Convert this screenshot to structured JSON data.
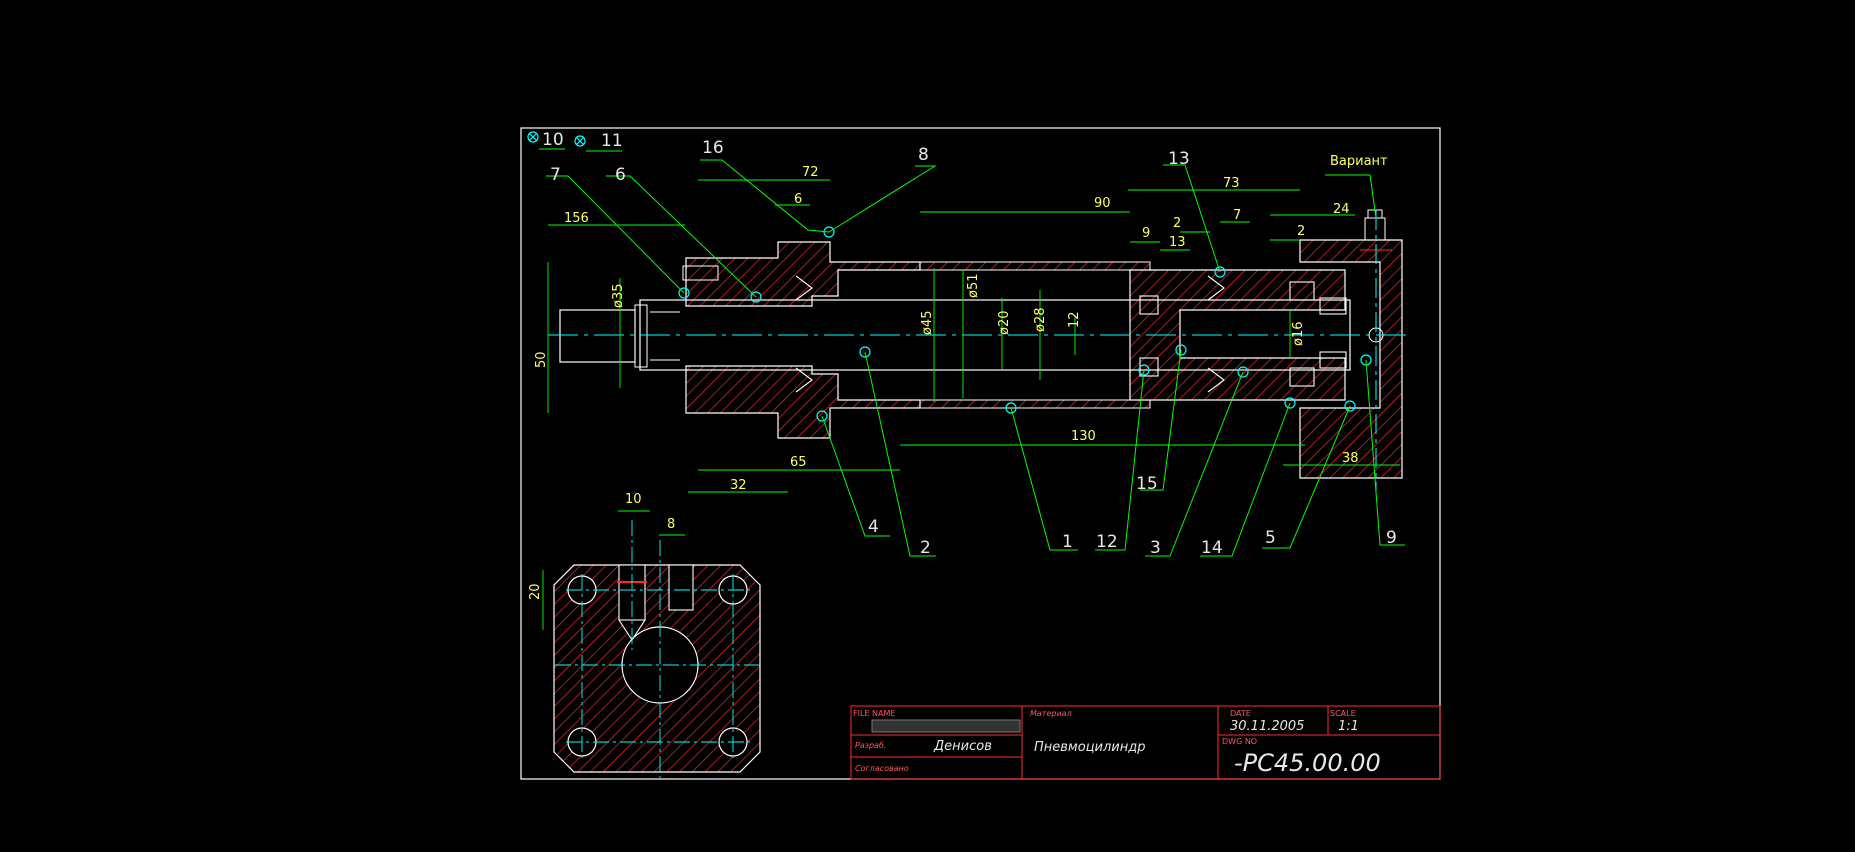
{
  "colors": {
    "background": "#000000",
    "frame": "#ffffff",
    "outline": "#ffffff",
    "centerline": "#00ffff",
    "hatch": "#ff2a2a",
    "leader": "#00ff00",
    "dimension": "#ffff00"
  },
  "legend": {
    "item_a": "10",
    "item_b": "11"
  },
  "variant_label": "Вариант",
  "callouts": [
    "16",
    "8",
    "7",
    "6",
    "13",
    "4",
    "2",
    "1",
    "12",
    "15",
    "3",
    "14",
    "5",
    "9"
  ],
  "dimensions": {
    "d72": "72",
    "d6": "6",
    "d156": "156",
    "d90": "90",
    "d73": "73",
    "d2a": "2",
    "d7": "7",
    "d24": "24",
    "d9": "9",
    "d13": "13",
    "d2b": "2",
    "dia35": "ø35",
    "d50": "50",
    "dia45": "ø45",
    "dia51": "ø51",
    "dia20": "ø20",
    "dia28": "ø28",
    "d12": "12",
    "dia16": "ø16",
    "d130": "130",
    "d65": "65",
    "d38": "38",
    "d32": "32",
    "d10": "10",
    "d8": "8",
    "d20": "20"
  },
  "title_block": {
    "file_name_label": "FILE NAME",
    "material_label": "Материал",
    "date_label": "DATE",
    "scale_label": "SCALE",
    "developer_label": "Разраб.",
    "checked_label": "Согласовано",
    "dwg_no_label": "DWG NO",
    "developer_name": "Денисов",
    "part_name": "Пневмоцилиндр",
    "date": "30.11.2005",
    "scale": "1:1",
    "dwg_no": "-PC45.00.00"
  }
}
